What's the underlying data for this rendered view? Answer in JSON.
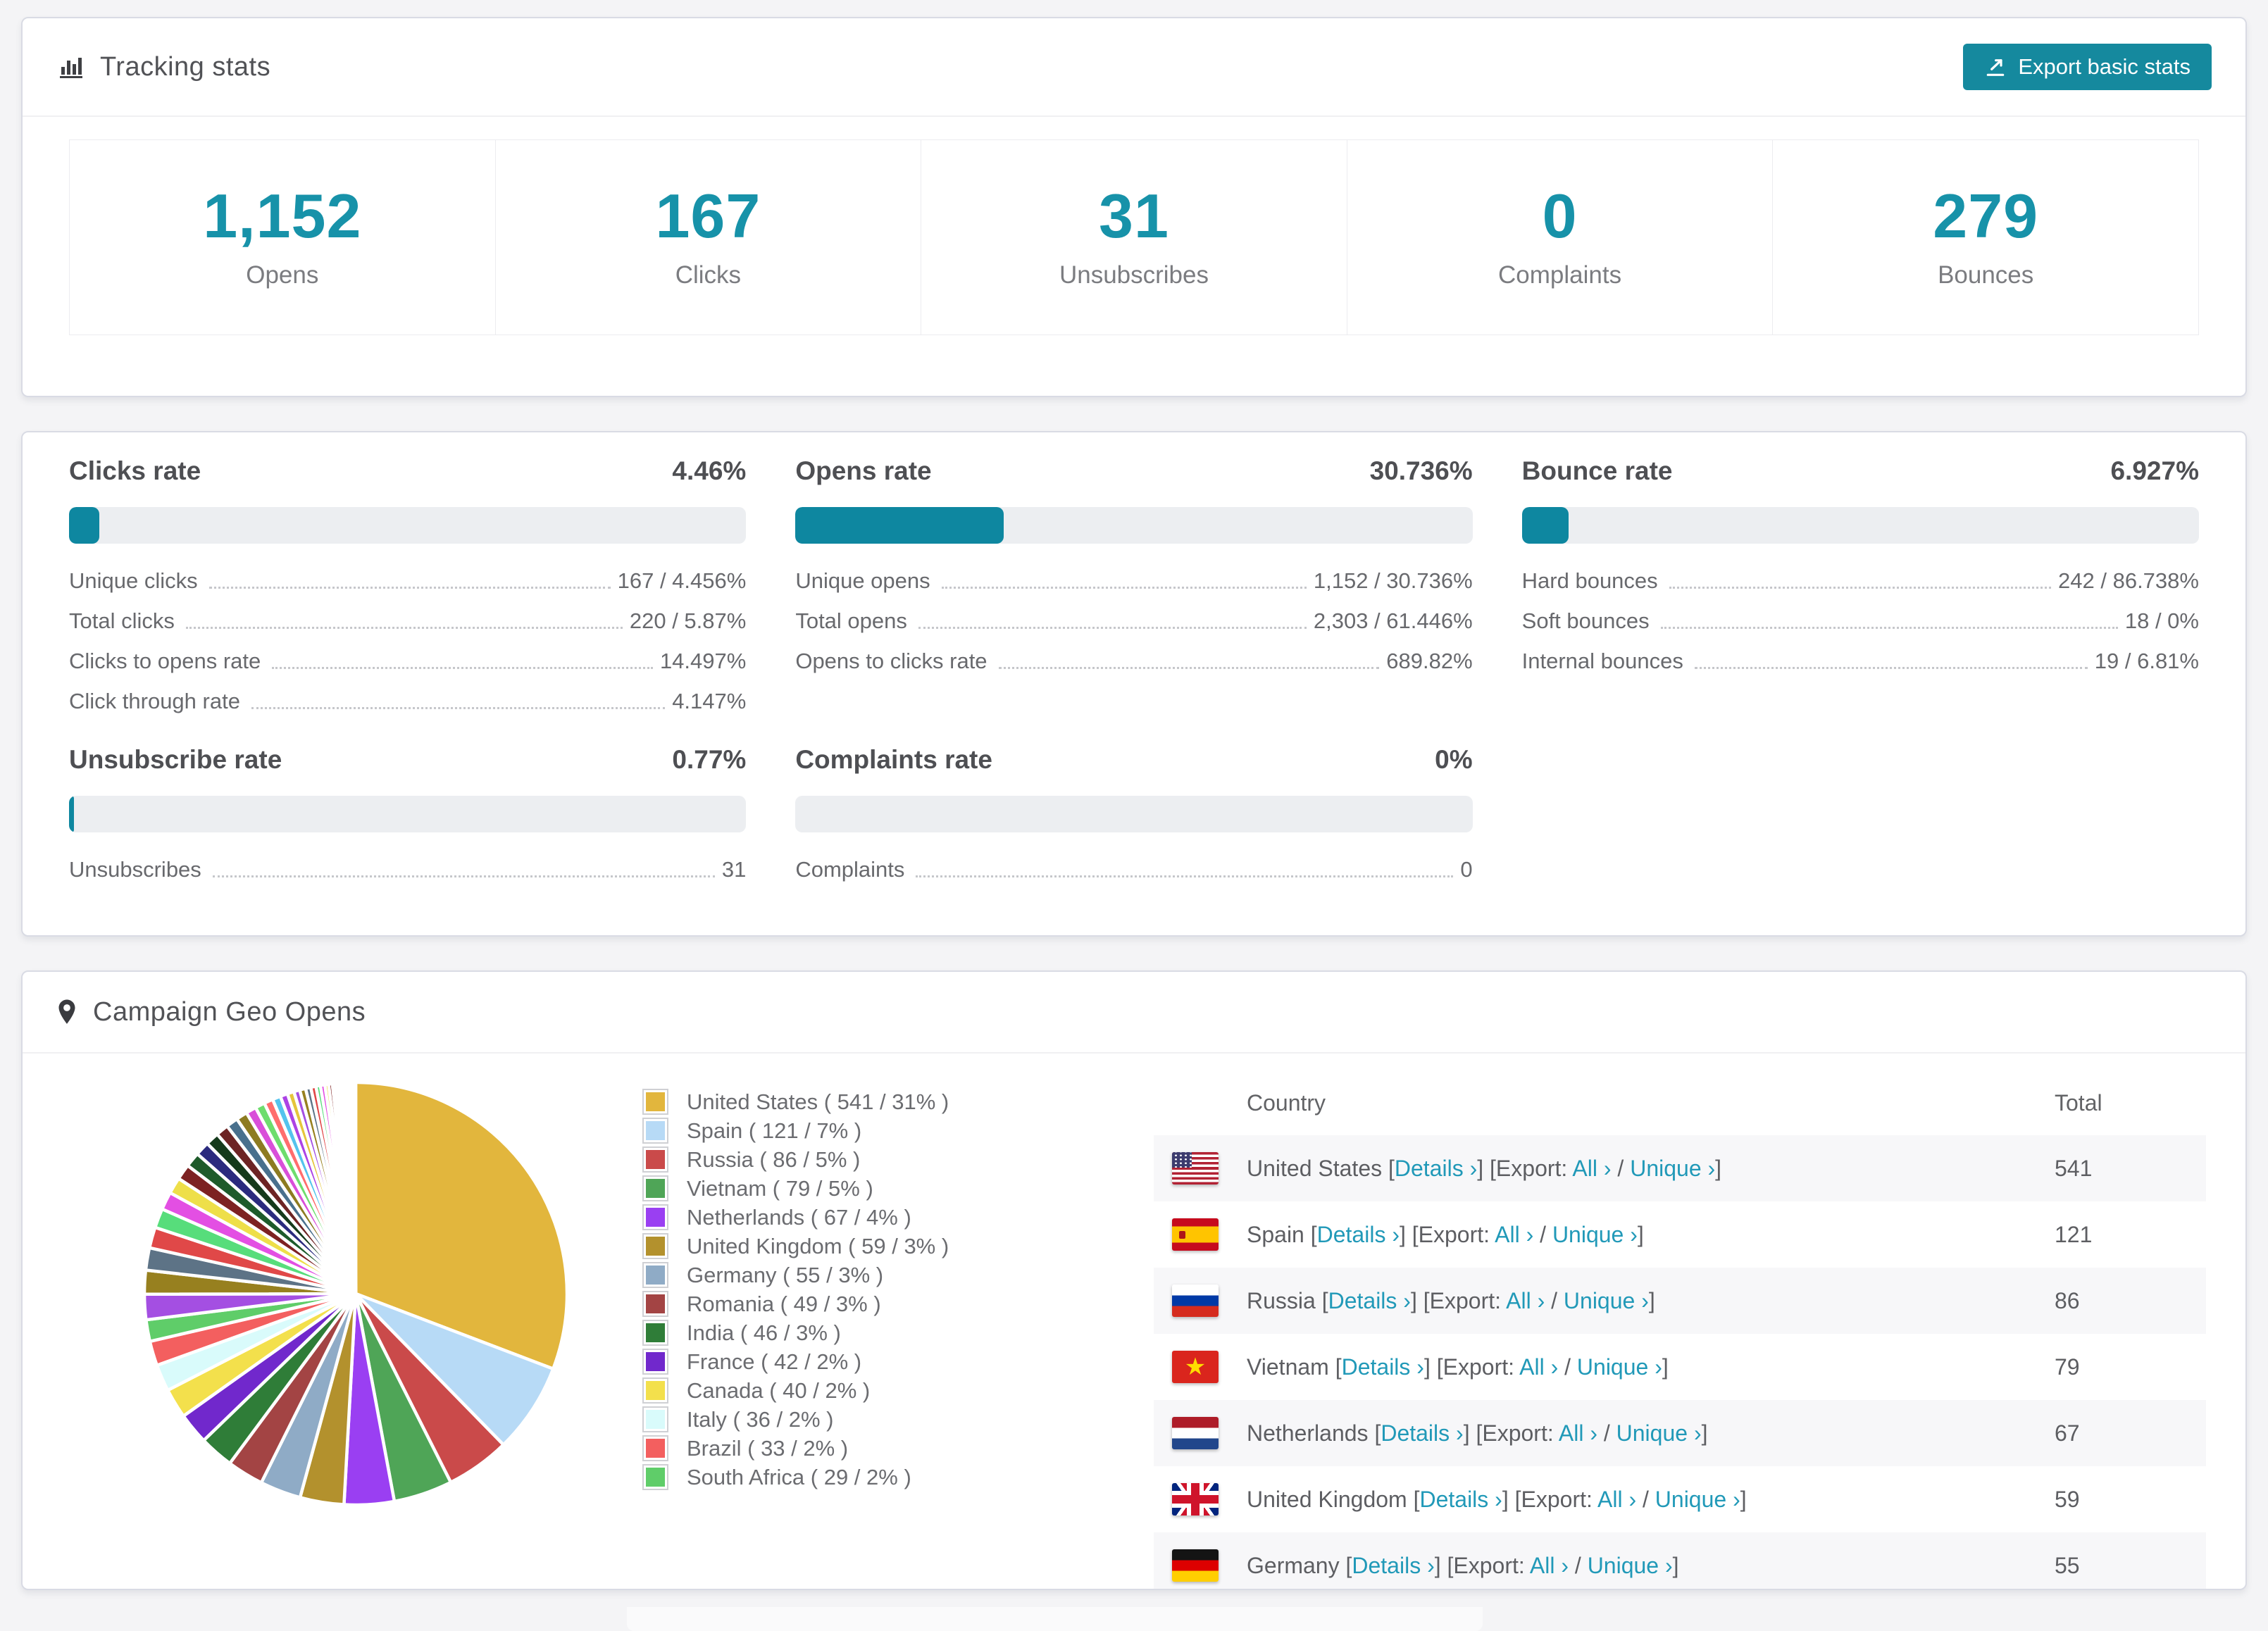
{
  "colors": {
    "accent_teal": "#15899e",
    "number_teal": "#1792a9",
    "bar_fill": "#0e87a0",
    "bar_track": "#eceef1",
    "link_teal": "#2199b8"
  },
  "tracking": {
    "title": "Tracking stats",
    "icon": "bar-chart-icon",
    "export_button": {
      "label": "Export basic stats",
      "icon": "export-icon"
    },
    "stats": [
      {
        "value": "1,152",
        "label": "Opens"
      },
      {
        "value": "167",
        "label": "Clicks"
      },
      {
        "value": "31",
        "label": "Unsubscribes"
      },
      {
        "value": "0",
        "label": "Complaints"
      },
      {
        "value": "279",
        "label": "Bounces"
      }
    ]
  },
  "rates": {
    "sections": [
      {
        "id": "clicks",
        "title": "Clicks rate",
        "value": "4.46%",
        "bar_pct": 4.46,
        "rows": [
          [
            "Unique clicks",
            "167 / 4.456%"
          ],
          [
            "Total clicks",
            "220 / 5.87%"
          ],
          [
            "Clicks to opens rate",
            "14.497%"
          ],
          [
            "Click through rate",
            "4.147%"
          ]
        ]
      },
      {
        "id": "opens",
        "title": "Opens rate",
        "value": "30.736%",
        "bar_pct": 30.736,
        "rows": [
          [
            "Unique opens",
            "1,152 / 30.736%"
          ],
          [
            "Total opens",
            "2,303 / 61.446%"
          ],
          [
            "Opens to clicks rate",
            "689.82%"
          ]
        ]
      },
      {
        "id": "bounce",
        "title": "Bounce rate",
        "value": "6.927%",
        "bar_pct": 6.927,
        "rows": [
          [
            "Hard bounces",
            "242 / 86.738%"
          ],
          [
            "Soft bounces",
            "18 / 0%"
          ],
          [
            "Internal bounces",
            "19 / 6.81%"
          ]
        ]
      },
      {
        "id": "unsubscribe",
        "title": "Unsubscribe rate",
        "value": "0.77%",
        "bar_pct": 0.77,
        "rows": [
          [
            "Unsubscribes",
            "31"
          ]
        ]
      },
      {
        "id": "complaints",
        "title": "Complaints rate",
        "value": "0%",
        "bar_pct": 0,
        "rows": [
          [
            "Complaints",
            "0"
          ]
        ]
      }
    ]
  },
  "geo": {
    "title": "Campaign Geo Opens",
    "icon": "map-marker-icon",
    "table": {
      "columns": [
        "Country",
        "Total"
      ],
      "link_labels": {
        "details": "Details ›",
        "export": "Export:",
        "all": "All ›",
        "unique": "Unique ›"
      },
      "punct": {
        "lb": " [",
        "mb": "] [",
        "slash": " / ",
        "rb": "]",
        "space": " "
      },
      "rows": [
        {
          "country": "United States",
          "flag": "us",
          "total": "541"
        },
        {
          "country": "Spain",
          "flag": "es",
          "total": "121"
        },
        {
          "country": "Russia",
          "flag": "ru",
          "total": "86"
        },
        {
          "country": "Vietnam",
          "flag": "vn",
          "total": "79"
        },
        {
          "country": "Netherlands",
          "flag": "nl",
          "total": "67"
        },
        {
          "country": "United Kingdom",
          "flag": "gb",
          "total": "59"
        },
        {
          "country": "Germany",
          "flag": "de",
          "total": "55"
        }
      ]
    }
  },
  "chart_data": {
    "type": "pie",
    "title": "Campaign Geo Opens",
    "legend_position": "right",
    "start_angle_deg": -90,
    "direction": "clockwise",
    "legend_format": "{name} ( {value} / {pct}% )",
    "series": [
      {
        "name": "United States",
        "value": 541,
        "pct": 31,
        "color": "#e2b63d"
      },
      {
        "name": "Spain",
        "value": 121,
        "pct": 7,
        "color": "#b7daf6"
      },
      {
        "name": "Russia",
        "value": 86,
        "pct": 5,
        "color": "#ca4a4a"
      },
      {
        "name": "Vietnam",
        "value": 79,
        "pct": 5,
        "color": "#4fa557"
      },
      {
        "name": "Netherlands",
        "value": 67,
        "pct": 4,
        "color": "#9a3ff2"
      },
      {
        "name": "United Kingdom",
        "value": 59,
        "pct": 3,
        "color": "#b3912d"
      },
      {
        "name": "Germany",
        "value": 55,
        "pct": 3,
        "color": "#8fabc6"
      },
      {
        "name": "Romania",
        "value": 49,
        "pct": 3,
        "color": "#a34444"
      },
      {
        "name": "India",
        "value": 46,
        "pct": 3,
        "color": "#2f7d38"
      },
      {
        "name": "France",
        "value": 42,
        "pct": 2,
        "color": "#7128cc"
      },
      {
        "name": "Canada",
        "value": 40,
        "pct": 2,
        "color": "#f3e04c"
      },
      {
        "name": "Italy",
        "value": 36,
        "pct": 2,
        "color": "#d9fbfb"
      },
      {
        "name": "Brazil",
        "value": 33,
        "pct": 2,
        "color": "#f35f5f"
      },
      {
        "name": "South Africa",
        "value": 29,
        "pct": 2,
        "color": "#5fcd69"
      }
    ],
    "others": {
      "note": "unlabeled small slices, estimated from pixels",
      "values": [
        34,
        32,
        30,
        28,
        26,
        24,
        22,
        21,
        20,
        19,
        18,
        17,
        16,
        15,
        14,
        13,
        12,
        11,
        10,
        9,
        8,
        8,
        7,
        7,
        6,
        6,
        5,
        5,
        4,
        4,
        3,
        3,
        3,
        2,
        2,
        2,
        2,
        1,
        1,
        1,
        1,
        1,
        1
      ],
      "palette": [
        "#a44fe2",
        "#97801f",
        "#5d7386",
        "#e04848",
        "#57dd7b",
        "#e34fe3",
        "#eedf49",
        "#7d2222",
        "#1e5b2b",
        "#2b2b7e",
        "#153a1b",
        "#6d2424",
        "#49708d",
        "#8d7b21",
        "#d94fd9",
        "#6ddd6d",
        "#ff6d6d",
        "#54c3ed",
        "#ac43e5",
        "#e5c53b"
      ]
    }
  }
}
